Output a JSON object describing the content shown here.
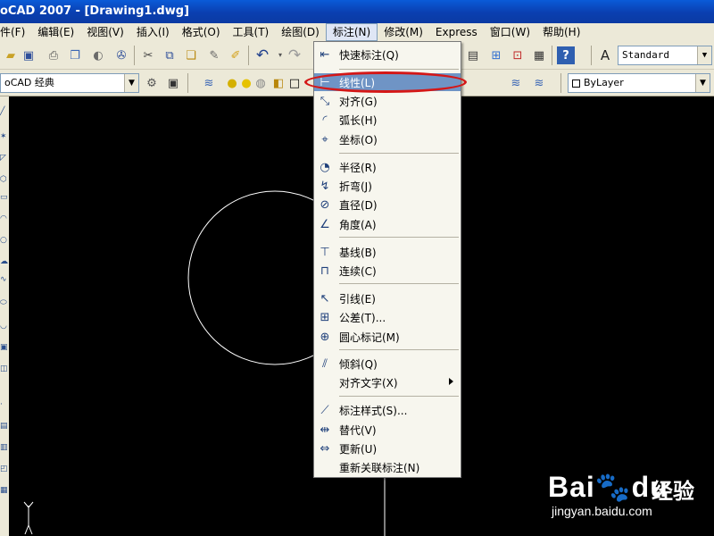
{
  "window": {
    "title": "oCAD 2007 - [Drawing1.dwg]"
  },
  "menubar": {
    "items": [
      {
        "label": "件(F)"
      },
      {
        "label": "编辑(E)"
      },
      {
        "label": "视图(V)"
      },
      {
        "label": "插入(I)"
      },
      {
        "label": "格式(O)"
      },
      {
        "label": "工具(T)"
      },
      {
        "label": "绘图(D)"
      },
      {
        "label": "标注(N)"
      },
      {
        "label": "修改(M)"
      },
      {
        "label": "Express"
      },
      {
        "label": "窗口(W)"
      },
      {
        "label": "帮助(H)"
      }
    ],
    "open_menu": "标注(N)"
  },
  "toolbar": {
    "text_style": "Standard",
    "workspace": "oCAD 经典",
    "linetype": "ByLayer"
  },
  "dimension_menu": {
    "items": [
      {
        "label": "快速标注(Q)",
        "icon": "quick-dimension-icon"
      },
      {
        "label": "线性(L)",
        "icon": "linear-dimension-icon",
        "highlighted": true
      },
      {
        "label": "对齐(G)",
        "icon": "aligned-dimension-icon"
      },
      {
        "label": "弧长(H)",
        "icon": "arc-length-icon"
      },
      {
        "label": "坐标(O)",
        "icon": "ordinate-icon"
      },
      {
        "label": "半径(R)",
        "icon": "radius-icon"
      },
      {
        "label": "折弯(J)",
        "icon": "jogged-icon"
      },
      {
        "label": "直径(D)",
        "icon": "diameter-icon"
      },
      {
        "label": "角度(A)",
        "icon": "angular-icon"
      },
      {
        "label": "基线(B)",
        "icon": "baseline-icon"
      },
      {
        "label": "连续(C)",
        "icon": "continue-icon"
      },
      {
        "label": "引线(E)",
        "icon": "leader-icon"
      },
      {
        "label": "公差(T)...",
        "icon": "tolerance-icon"
      },
      {
        "label": "圆心标记(M)",
        "icon": "center-mark-icon"
      },
      {
        "label": "倾斜(Q)",
        "icon": "oblique-icon"
      },
      {
        "label": "对齐文字(X)",
        "icon": "",
        "submenu": true
      },
      {
        "label": "标注样式(S)...",
        "icon": "dimension-style-icon"
      },
      {
        "label": "替代(V)",
        "icon": "override-icon"
      },
      {
        "label": "更新(U)",
        "icon": "update-icon"
      },
      {
        "label": "重新关联标注(N)",
        "icon": ""
      }
    ]
  },
  "watermark": {
    "brand": "Bai",
    "brand_suffix": "du",
    "experience": "经验",
    "url": "jingyan.baidu.com"
  },
  "colors": {
    "canvas": "#000000",
    "highlight": "#6f94c5",
    "annotation_ring": "#d41717"
  }
}
